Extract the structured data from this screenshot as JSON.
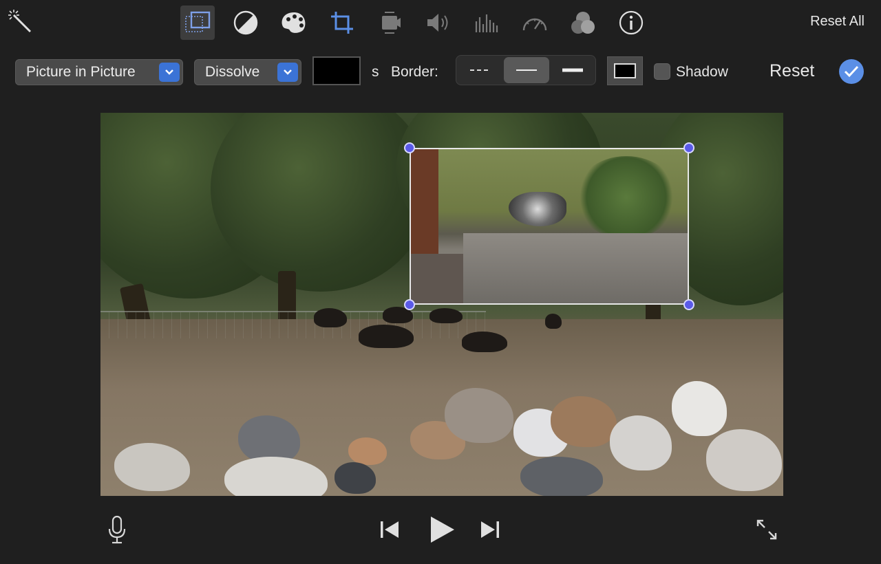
{
  "toolbar": {
    "reset_all_label": "Reset All",
    "tools": [
      {
        "icon": "magic-wand-icon"
      },
      {
        "icon": "video-overlay-icon",
        "active": true
      },
      {
        "icon": "color-balance-icon"
      },
      {
        "icon": "color-correction-palette-icon"
      },
      {
        "icon": "crop-icon"
      },
      {
        "icon": "stabilization-icon"
      },
      {
        "icon": "volume-icon"
      },
      {
        "icon": "noise-reduction-equalizer-icon"
      },
      {
        "icon": "speed-gauge-icon"
      },
      {
        "icon": "clip-filter-icon"
      },
      {
        "icon": "info-icon"
      }
    ]
  },
  "controls": {
    "overlay_style": "Picture in Picture",
    "transition": "Dissolve",
    "duration_unit": "s",
    "border_label": "Border:",
    "shadow_label": "Shadow",
    "shadow_checked": false,
    "reset_label": "Reset",
    "border_styles": [
      "dashed",
      "thin",
      "thick"
    ],
    "border_selected": "thin",
    "border_color": "#000000",
    "accent_color": "#3b73d6"
  },
  "viewer": {
    "handle_color": "#5a5ae8"
  },
  "transport": {
    "icons": [
      "microphone-icon",
      "skip-back-icon",
      "play-icon",
      "skip-forward-icon",
      "fullscreen-icon"
    ]
  }
}
